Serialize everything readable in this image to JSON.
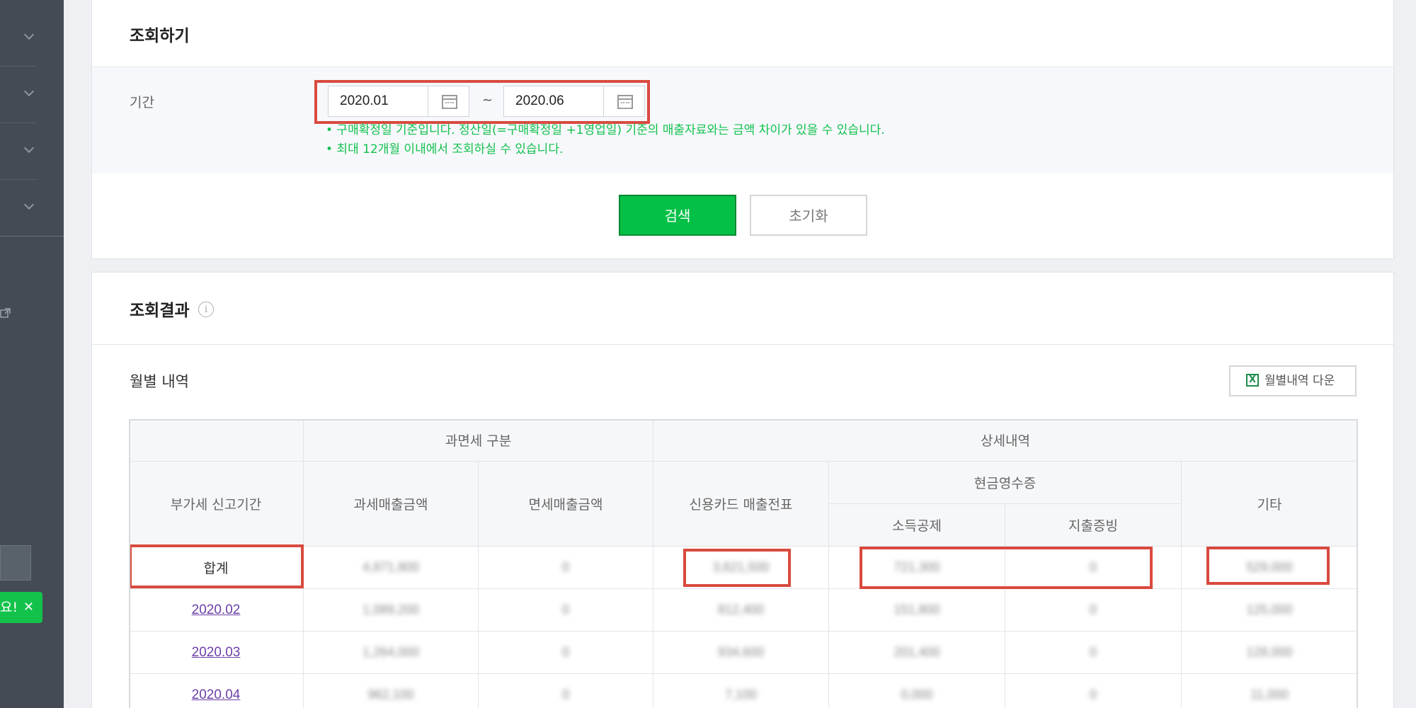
{
  "sidebar": {
    "toast": {
      "text": "요!",
      "close": "✕"
    }
  },
  "search": {
    "title": "조회하기",
    "period_label": "기간",
    "start_value": "2020.01",
    "end_value": "2020.06",
    "separator": "~",
    "notes": [
      "• 구매확정일 기준입니다. 정산일(=구매확정일 +1영업일) 기준의 매출자료와는 금액 차이가 있을 수 있습니다.",
      "• 최대 12개월 이내에서 조회하실 수 있습니다."
    ],
    "search_button": "검색",
    "reset_button": "초기화"
  },
  "results": {
    "title": "조회결과",
    "info_icon": "i",
    "subtitle": "월별 내역",
    "download_button": "월별내역 다운",
    "download_icon": "X",
    "table": {
      "group_headers": {
        "tax_type": "과면세 구분",
        "detail": "상세내역",
        "cash_receipt": "현금영수증"
      },
      "columns": {
        "period": "부가세 신고기간",
        "taxable": "과세매출금액",
        "exempt": "면세매출금액",
        "card": "신용카드 매출전표",
        "income_deduction": "소득공제",
        "expense_proof": "지출증빙",
        "other": "기타"
      },
      "rows": [
        {
          "period": "합계",
          "taxable": "4,871,800",
          "exempt": "0",
          "card": "3,621,500",
          "income_deduction": "721,300",
          "expense_proof": "0",
          "other": "529,000"
        },
        {
          "period": "2020.02",
          "taxable": "1,089,200",
          "exempt": "0",
          "card": "812,400",
          "income_deduction": "151,800",
          "expense_proof": "0",
          "other": "125,000"
        },
        {
          "period": "2020.03",
          "taxable": "1,264,000",
          "exempt": "0",
          "card": "934,600",
          "income_deduction": "201,400",
          "expense_proof": "0",
          "other": "128,000"
        },
        {
          "period": "2020.04",
          "taxable": "962,100",
          "exempt": "0",
          "card": "7,100",
          "income_deduction": "0,000",
          "expense_proof": "0",
          "other": "11,000"
        }
      ]
    }
  },
  "colors": {
    "accent": "#05c046",
    "highlight_box": "#d94a3f",
    "note_text": "#11c14d",
    "link": "#6b3fa8"
  }
}
